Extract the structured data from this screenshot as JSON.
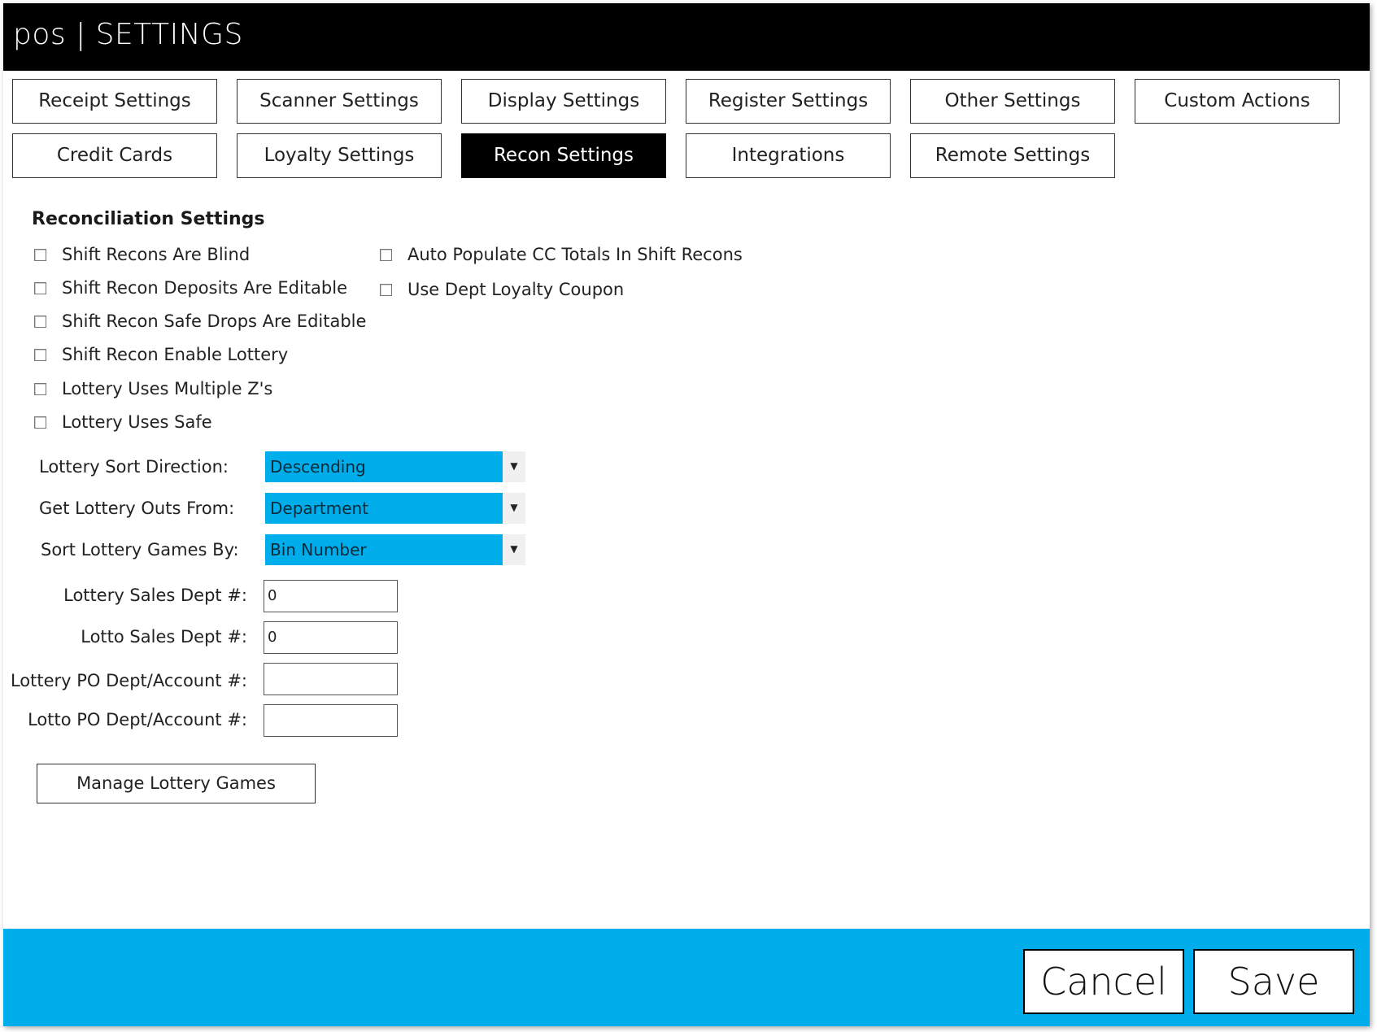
{
  "window": {
    "title": "pos | SETTINGS"
  },
  "tabs": [
    {
      "label": "Receipt Settings",
      "active": false
    },
    {
      "label": "Scanner Settings",
      "active": false
    },
    {
      "label": "Display Settings",
      "active": false
    },
    {
      "label": "Register Settings",
      "active": false
    },
    {
      "label": "Other Settings",
      "active": false
    },
    {
      "label": "Custom Actions",
      "active": false
    },
    {
      "label": "Credit Cards",
      "active": false
    },
    {
      "label": "Loyalty Settings",
      "active": false
    },
    {
      "label": "Recon Settings",
      "active": true
    },
    {
      "label": "Integrations",
      "active": false
    },
    {
      "label": "Remote Settings",
      "active": false
    }
  ],
  "section": {
    "title": "Reconciliation Settings"
  },
  "checkboxes": [
    {
      "label": "Shift Recons Are Blind",
      "checked": false
    },
    {
      "label": "Shift Recon Deposits Are Editable",
      "checked": false
    },
    {
      "label": "Shift Recon Safe Drops Are Editable",
      "checked": false
    },
    {
      "label": "Shift Recon Enable Lottery",
      "checked": false
    },
    {
      "label": "Lottery Uses Multiple Z's",
      "checked": false
    },
    {
      "label": "Lottery Uses Safe",
      "checked": false
    },
    {
      "label": "Auto Populate CC Totals In Shift Recons",
      "checked": false
    },
    {
      "label": "Use Dept Loyalty Coupon",
      "checked": false
    }
  ],
  "dropdowns": [
    {
      "label": "Lottery Sort Direction:",
      "value": "Descending"
    },
    {
      "label": "Get Lottery Outs From:",
      "value": "Department"
    },
    {
      "label": "Sort Lottery Games By:",
      "value": "Bin Number"
    }
  ],
  "fields": [
    {
      "label": "Lottery Sales Dept #:",
      "value": "0"
    },
    {
      "label": "Lotto Sales Dept #:",
      "value": "0"
    },
    {
      "label": "Lottery PO Dept/Account #:",
      "value": ""
    },
    {
      "label": "Lotto PO Dept/Account #:",
      "value": ""
    }
  ],
  "buttons": {
    "manage_lottery_games": "Manage Lottery Games",
    "cancel": "Cancel",
    "save": "Save"
  },
  "colors": {
    "accent": "#00adeb",
    "titlebar": "#000000"
  }
}
